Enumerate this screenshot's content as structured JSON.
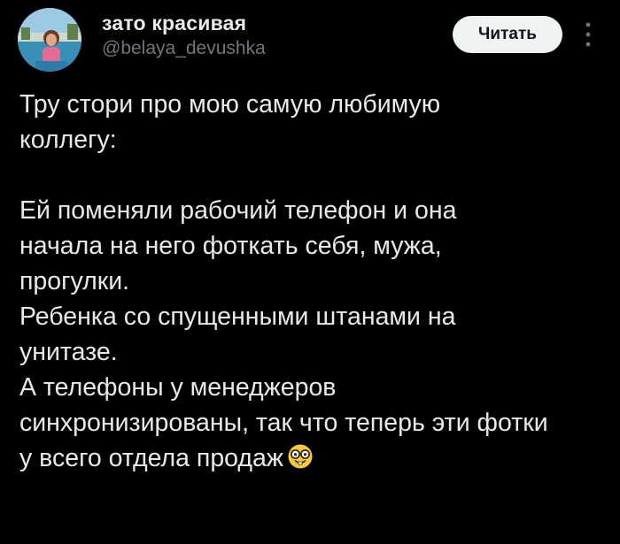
{
  "author": {
    "display_name": "зато красивая",
    "handle": "@belaya_devushka",
    "avatar_icon": "profile-photo"
  },
  "header": {
    "follow_label": "Читать",
    "more_icon": "vertical-ellipsis-icon"
  },
  "tweet": {
    "paragraph_1": "Тру стори про мою самую любимую коллегу:",
    "paragraph_2": "Ей поменяли рабочий телефон и она начала на него фоткать себя, мужа, прогулки.",
    "paragraph_3": "Ребенка со спущенными штанами на унитазе.",
    "paragraph_4": "А телефоны у менеджеров синхронизированы, так что теперь эти фотки у всего отдела продаж",
    "trailing_emoji": "nerd-face-emoji"
  },
  "colors": {
    "background": "#000000",
    "text_primary": "#e7e9ea",
    "text_secondary": "#71767b",
    "button_bg": "#eff3f4",
    "button_text": "#0f1419"
  }
}
